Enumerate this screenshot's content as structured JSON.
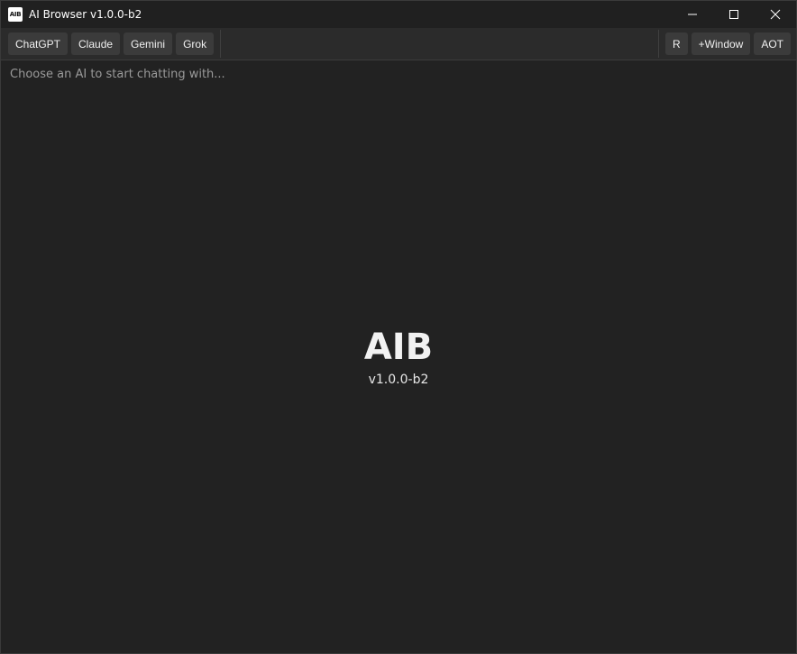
{
  "window": {
    "title": "AI Browser v1.0.0-b2",
    "app_icon_text": "AIB",
    "controls": {
      "minimize_icon": "minimize-icon",
      "maximize_icon": "maximize-icon",
      "close_icon": "close-icon"
    }
  },
  "toolbar": {
    "ai_buttons": [
      "ChatGPT",
      "Claude",
      "Gemini",
      "Grok"
    ],
    "right_buttons": {
      "reload": "R",
      "new_window": "+Window",
      "always_on_top": "AOT"
    }
  },
  "content": {
    "hint": "Choose an AI to start chatting with...",
    "logo": "AIB",
    "version": "v1.0.0-b2"
  },
  "colors": {
    "background": "#222222",
    "titlebar": "#202020",
    "toolbar": "#2b2b2b",
    "button": "#3b3b3b",
    "text": "#f0f0f0",
    "hint": "#9a9a9a"
  }
}
